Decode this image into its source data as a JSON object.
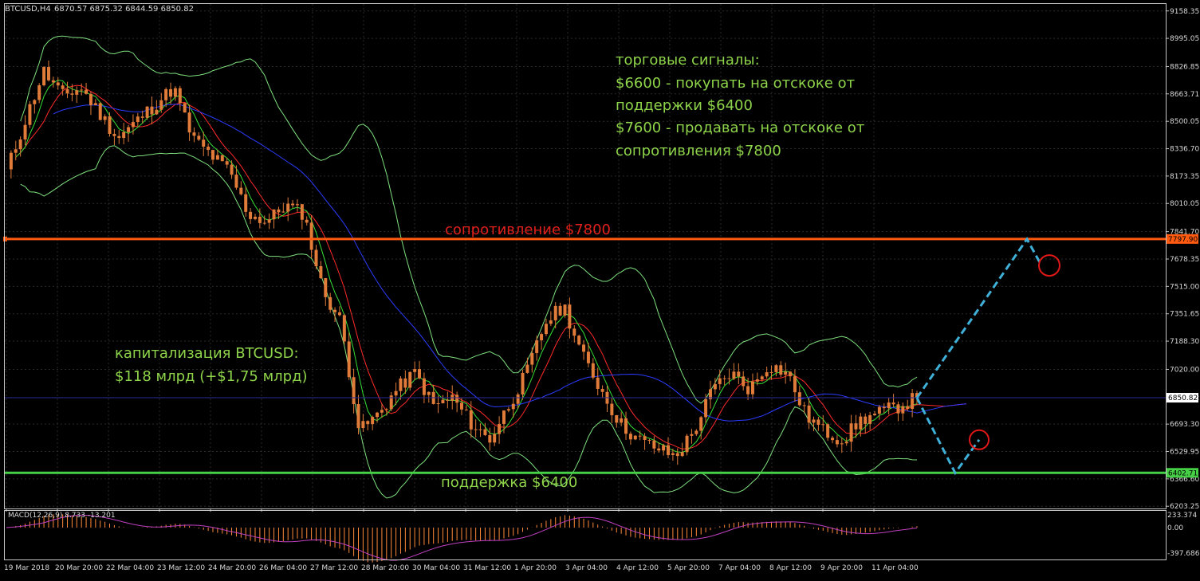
{
  "header": {
    "symbol": "BTCUSD,H4",
    "ohlc": "6870.57 6875.32 6844.59 6850.82"
  },
  "colors": {
    "background": "#000000",
    "grid": "#2a2a2a",
    "candle": "#e07b39",
    "bollinger": "#7ee07e",
    "ma_red": "#ff2a2a",
    "ma_green": "#36e036",
    "ma_blue": "#2a3cff",
    "resistance": "#ff5a10",
    "support": "#45d045",
    "forecast": "#3fb0d8",
    "circle": "#e01818",
    "annotation_green": "#8ed44a",
    "annotation_red": "#e0201a",
    "macd": "#ff8a3a",
    "signal": "#c040c0"
  },
  "annotations": {
    "signals_title": "торговые сигналы:",
    "signal_1a": "$6600 - покупать на отскоке от",
    "signal_1b": "поддержки $6400",
    "signal_2a": "$7600 - продавать на отскоке от",
    "signal_2b": "сопротивления $7800",
    "resistance_label": "сопротивление $7800",
    "support_label": "поддержка $6400",
    "cap_title": "капитализация BTCUSD:",
    "cap_value": "$118 млрд (+$1,75 млрд)"
  },
  "macd": {
    "label": "MACD(12,26,9) 8.733 -13.201",
    "ticks": [
      "233.374",
      "0.00",
      "-397.686"
    ]
  },
  "chart_data": {
    "type": "candlestick",
    "symbol": "BTCUSD",
    "timeframe": "H4",
    "ylim": [
      6203.25,
      9200
    ],
    "y_ticks": [
      "9158.35",
      "8995.05",
      "8826.85",
      "8663.71",
      "8500.05",
      "8336.70",
      "8173.35",
      "8010.05",
      "7841.70",
      "7678.35",
      "7515.00",
      "7351.65",
      "7188.30",
      "7020.00",
      "6850.82",
      "6693.30",
      "6529.95",
      "6366.60",
      "6203.25"
    ],
    "x_ticks": [
      "19 Mar 2018",
      "20 Mar 20:00",
      "22 Mar 04:00",
      "23 Mar 12:00",
      "24 Mar 20:00",
      "26 Mar 04:00",
      "27 Mar 12:00",
      "28 Mar 20:00",
      "30 Mar 04:00",
      "31 Mar 12:00",
      "1 Apr 20:00",
      "3 Apr 04:00",
      "4 Apr 12:00",
      "5 Apr 20:00",
      "7 Apr 04:00",
      "8 Apr 12:00",
      "9 Apr 20:00",
      "11 Apr 04:00"
    ],
    "last_price": 6850.82,
    "resistance": {
      "price": 7797.9,
      "label": "7797.90"
    },
    "support": {
      "price": 6402.71,
      "label": "6402.71"
    },
    "close_anchors": [
      8200,
      8500,
      8800,
      8650,
      8700,
      8550,
      8400,
      8500,
      8600,
      8700,
      8400,
      8300,
      8200,
      7950,
      7900,
      8000,
      7950,
      7500,
      7300,
      6650,
      6750,
      6900,
      7000,
      6800,
      6850,
      6700,
      6600,
      6800,
      7000,
      7300,
      7400,
      7100,
      6900,
      6700,
      6600,
      6550,
      6500,
      6650,
      6900,
      7000,
      6900,
      7050,
      7000,
      6750,
      6650,
      6600,
      6720,
      6760,
      6800,
      6850
    ],
    "forecast_path": [
      {
        "date": "11 Apr 12:00",
        "price": 6850
      },
      {
        "date": "12 Apr 16:00",
        "price": 6402
      },
      {
        "date": "13 Apr 04:00",
        "price": 6600
      }
    ],
    "forecast_path_up": [
      {
        "date": "11 Apr 12:00",
        "price": 6850
      },
      {
        "date": "14 Apr 00:00",
        "price": 7797
      },
      {
        "date": "14 Apr 04:00",
        "price": 7650
      }
    ]
  }
}
